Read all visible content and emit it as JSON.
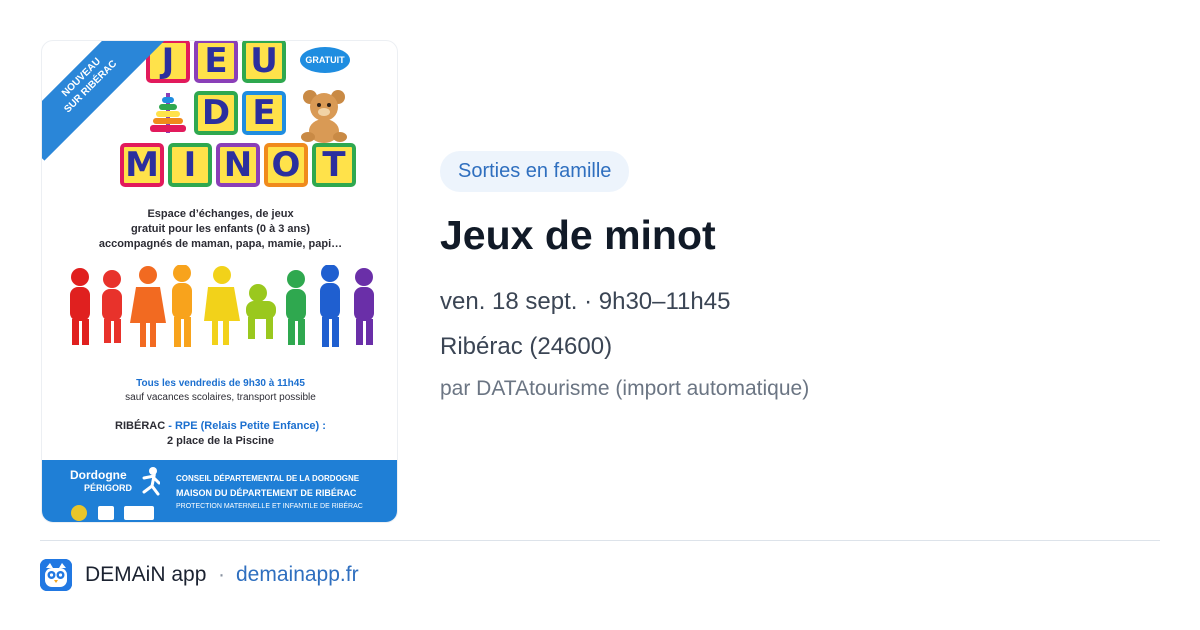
{
  "event": {
    "category": "Sorties en famille",
    "title": "Jeux de minot",
    "datetime": "ven. 18 sept. · 9h30–11h45",
    "location": "Ribérac (24600)",
    "author": "par DATAtourisme (import automatique)"
  },
  "poster": {
    "ribbon_line1": "NOUVEAU",
    "ribbon_line2": "SUR RIBÉRAC",
    "title_letters": [
      "J",
      "E",
      "U",
      "D",
      "E",
      "M",
      "I",
      "N",
      "O",
      "T"
    ],
    "badge": "GRATUIT",
    "description": [
      "Espace d’échanges, de jeux",
      "gratuit pour les enfants (0 à 3 ans)",
      "accompagnés de maman, papa, mamie, papi…"
    ],
    "schedule": "Tous les vendredis de 9h30 à 11h45",
    "schedule_note": "sauf vacances scolaires, transport possible",
    "place_name": "RIBÉRAC",
    "place_org": " - RPE (Relais Petite Enfance) :",
    "place_address": "2 place de la Piscine",
    "footer_brand": "Dordogne",
    "footer_brand_sub": "PÉRIGORD",
    "footer_lines": [
      "CONSEIL DÉPARTEMENTAL DE LA DORDOGNE",
      "MAISON DU DÉPARTEMENT DE RIBÉRAC",
      "PROTECTION MATERNELLE ET INFANTILE DE RIBÉRAC"
    ],
    "cube_colors": [
      "#e21a5c",
      "#2fa84f",
      "#8a3fb8",
      "#f08a1c",
      "#1f8de0"
    ]
  },
  "source": {
    "app_name": "DEMAiN app",
    "separator": "·",
    "domain": "demainapp.fr"
  },
  "colors": {
    "accent": "#2f6fbf",
    "tag_bg": "#edf4fc",
    "title": "#111a27",
    "muted": "#6b7583"
  },
  "icons": {
    "app": "owl-logo-icon",
    "poster_toy": "teddy-bear-icon"
  }
}
